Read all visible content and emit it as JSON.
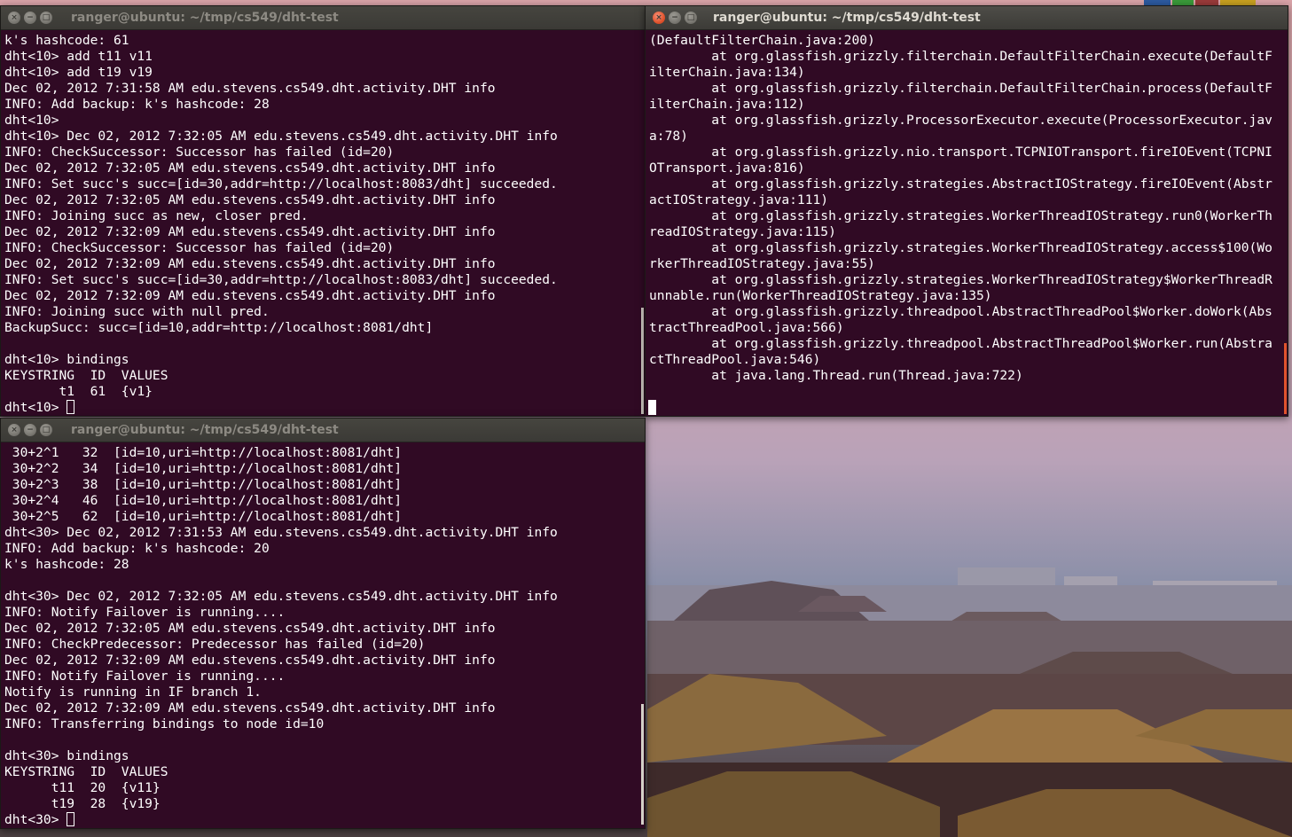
{
  "colors": {
    "terminal_bg": "#300a24",
    "terminal_fg": "#ffffff",
    "titlebar": "#3c3b37",
    "close_button": "#e0532d"
  },
  "windows": [
    {
      "title": "ranger@ubuntu: ~/tmp/cs549/dht-test",
      "active": false,
      "lines": [
        "k's hashcode: 61",
        "dht<10> add t11 v11",
        "dht<10> add t19 v19",
        "Dec 02, 2012 7:31:58 AM edu.stevens.cs549.dht.activity.DHT info",
        "INFO: Add backup: k's hashcode: 28",
        "dht<10>",
        "dht<10> Dec 02, 2012 7:32:05 AM edu.stevens.cs549.dht.activity.DHT info",
        "INFO: CheckSuccessor: Successor has failed (id=20)",
        "Dec 02, 2012 7:32:05 AM edu.stevens.cs549.dht.activity.DHT info",
        "INFO: Set succ's succ=[id=30,addr=http://localhost:8083/dht] succeeded.",
        "Dec 02, 2012 7:32:05 AM edu.stevens.cs549.dht.activity.DHT info",
        "INFO: Joining succ as new, closer pred.",
        "Dec 02, 2012 7:32:09 AM edu.stevens.cs549.dht.activity.DHT info",
        "INFO: CheckSuccessor: Successor has failed (id=20)",
        "Dec 02, 2012 7:32:09 AM edu.stevens.cs549.dht.activity.DHT info",
        "INFO: Set succ's succ=[id=30,addr=http://localhost:8083/dht] succeeded.",
        "Dec 02, 2012 7:32:09 AM edu.stevens.cs549.dht.activity.DHT info",
        "INFO: Joining succ with null pred.",
        "BackupSucc: succ=[id=10,addr=http://localhost:8081/dht]",
        "",
        "dht<10> bindings",
        "KEYSTRING  ID  VALUES",
        "       t1  61  {v1}"
      ],
      "prompt": "dht<10> "
    },
    {
      "title": "ranger@ubuntu: ~/tmp/cs549/dht-test",
      "active": true,
      "lines": [
        "(DefaultFilterChain.java:200)",
        "        at org.glassfish.grizzly.filterchain.DefaultFilterChain.execute(DefaultF",
        "ilterChain.java:134)",
        "        at org.glassfish.grizzly.filterchain.DefaultFilterChain.process(DefaultF",
        "ilterChain.java:112)",
        "        at org.glassfish.grizzly.ProcessorExecutor.execute(ProcessorExecutor.jav",
        "a:78)",
        "        at org.glassfish.grizzly.nio.transport.TCPNIOTransport.fireIOEvent(TCPNI",
        "OTransport.java:816)",
        "        at org.glassfish.grizzly.strategies.AbstractIOStrategy.fireIOEvent(Abstr",
        "actIOStrategy.java:111)",
        "        at org.glassfish.grizzly.strategies.WorkerThreadIOStrategy.run0(WorkerTh",
        "readIOStrategy.java:115)",
        "        at org.glassfish.grizzly.strategies.WorkerThreadIOStrategy.access$100(Wo",
        "rkerThreadIOStrategy.java:55)",
        "        at org.glassfish.grizzly.strategies.WorkerThreadIOStrategy$WorkerThreadR",
        "unnable.run(WorkerThreadIOStrategy.java:135)",
        "        at org.glassfish.grizzly.threadpool.AbstractThreadPool$Worker.doWork(Abs",
        "tractThreadPool.java:566)",
        "        at org.glassfish.grizzly.threadpool.AbstractThreadPool$Worker.run(Abstra",
        "ctThreadPool.java:546)",
        "        at java.lang.Thread.run(Thread.java:722)"
      ],
      "prompt": ""
    },
    {
      "title": "ranger@ubuntu: ~/tmp/cs549/dht-test",
      "active": false,
      "lines": [
        " 30+2^1   32  [id=10,uri=http://localhost:8081/dht]",
        " 30+2^2   34  [id=10,uri=http://localhost:8081/dht]",
        " 30+2^3   38  [id=10,uri=http://localhost:8081/dht]",
        " 30+2^4   46  [id=10,uri=http://localhost:8081/dht]",
        " 30+2^5   62  [id=10,uri=http://localhost:8081/dht]",
        "dht<30> Dec 02, 2012 7:31:53 AM edu.stevens.cs549.dht.activity.DHT info",
        "INFO: Add backup: k's hashcode: 20",
        "k's hashcode: 28",
        "",
        "dht<30> Dec 02, 2012 7:32:05 AM edu.stevens.cs549.dht.activity.DHT info",
        "INFO: Notify Failover is running....",
        "Dec 02, 2012 7:32:05 AM edu.stevens.cs549.dht.activity.DHT info",
        "INFO: CheckPredecessor: Predecessor has failed (id=20)",
        "Dec 02, 2012 7:32:09 AM edu.stevens.cs549.dht.activity.DHT info",
        "INFO: Notify Failover is running....",
        "Notify is running in IF branch 1.",
        "Dec 02, 2012 7:32:09 AM edu.stevens.cs549.dht.activity.DHT info",
        "INFO: Transferring bindings to node id=10",
        "",
        "dht<30> bindings",
        "KEYSTRING  ID  VALUES",
        "      t11  20  {v11}",
        "      t19  28  {v19}"
      ],
      "prompt": "dht<30> "
    }
  ],
  "window_controls": {
    "close": "×",
    "minimize": "−",
    "maximize": "□"
  }
}
